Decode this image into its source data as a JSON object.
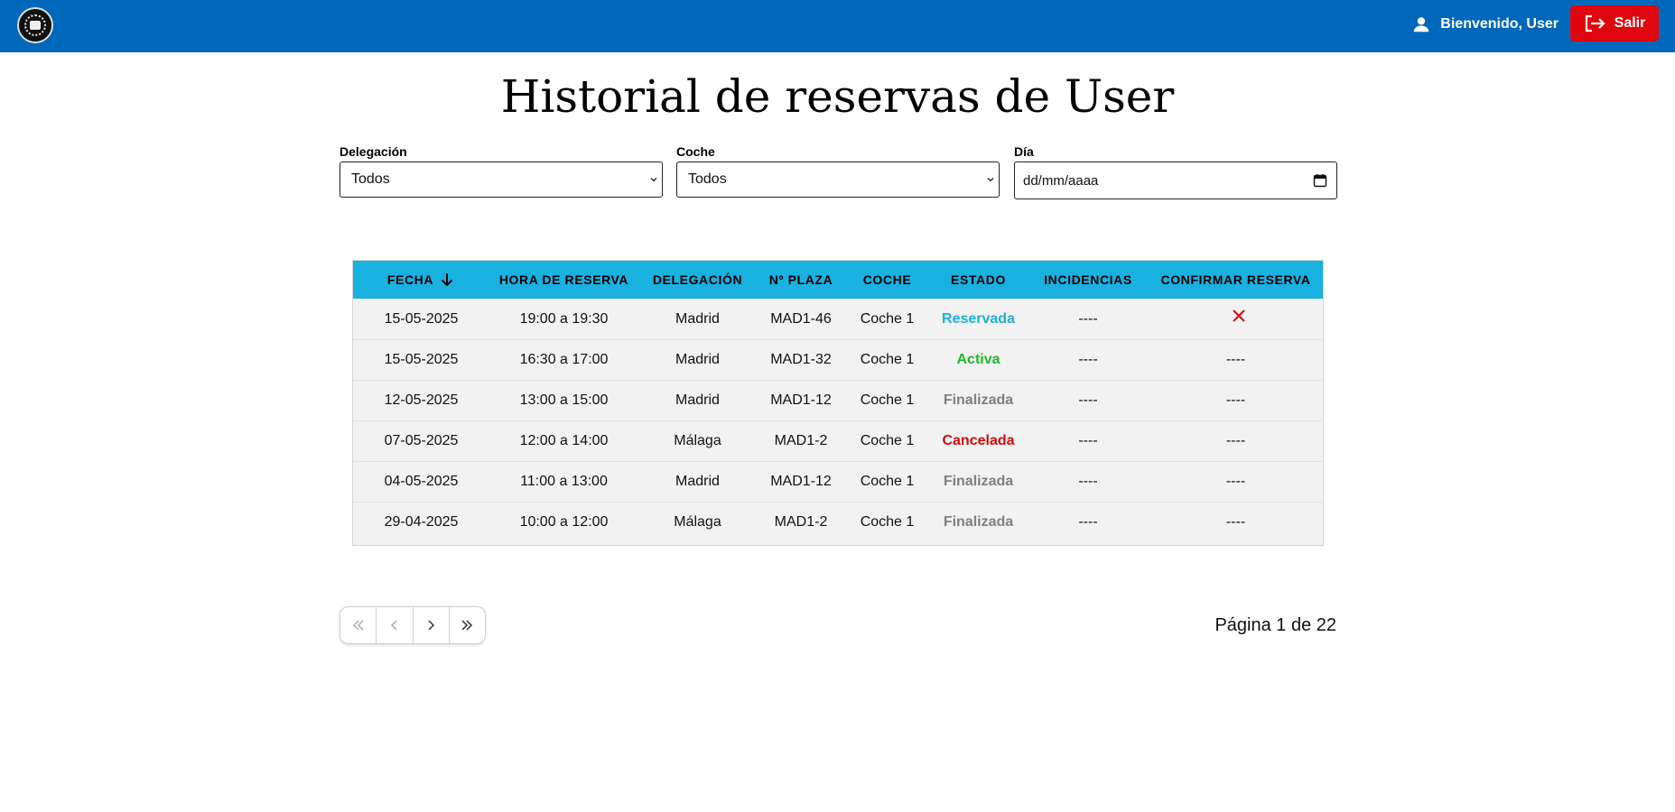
{
  "header": {
    "logo_icon": "emblem-logo",
    "welcome_text": "Bienvenido, User",
    "logout_label": "Salir",
    "colors": {
      "bar": "#0068bb",
      "logout": "#e0060e"
    }
  },
  "page_title": "Historial de reservas de User",
  "filters": {
    "delegacion": {
      "label": "Delegación",
      "value": "Todos"
    },
    "coche": {
      "label": "Coche",
      "value": "Todos"
    },
    "dia": {
      "label": "Día",
      "placeholder": "dd/mm/aaaa"
    }
  },
  "table": {
    "header_color": "#19b1e0",
    "columns": [
      "FECHA",
      "HORA DE RESERVA",
      "DELEGACIÓN",
      "Nº PLAZA",
      "COCHE",
      "ESTADO",
      "INCIDENCIAS",
      "CONFIRMAR RESERVA"
    ],
    "sort": {
      "column": "FECHA",
      "direction": "desc",
      "icon": "arrow-down-icon"
    },
    "rows": [
      {
        "fecha": "15-05-2025",
        "hora": "19:00 a 19:30",
        "delegacion": "Madrid",
        "plaza": "MAD1-46",
        "coche": "Coche 1",
        "estado": "Reservada",
        "incidencias": "----",
        "confirmar": "x-icon"
      },
      {
        "fecha": "15-05-2025",
        "hora": "16:30 a 17:00",
        "delegacion": "Madrid",
        "plaza": "MAD1-32",
        "coche": "Coche 1",
        "estado": "Activa",
        "incidencias": "----",
        "confirmar": "----"
      },
      {
        "fecha": "12-05-2025",
        "hora": "13:00 a 15:00",
        "delegacion": "Madrid",
        "plaza": "MAD1-12",
        "coche": "Coche 1",
        "estado": "Finalizada",
        "incidencias": "----",
        "confirmar": "----"
      },
      {
        "fecha": "07-05-2025",
        "hora": "12:00 a 14:00",
        "delegacion": "Málaga",
        "plaza": "MAD1-2",
        "coche": "Coche 1",
        "estado": "Cancelada",
        "incidencias": "----",
        "confirmar": "----"
      },
      {
        "fecha": "04-05-2025",
        "hora": "11:00 a 13:00",
        "delegacion": "Madrid",
        "plaza": "MAD1-12",
        "coche": "Coche 1",
        "estado": "Finalizada",
        "incidencias": "----",
        "confirmar": "----"
      },
      {
        "fecha": "29-04-2025",
        "hora": "10:00 a 12:00",
        "delegacion": "Málaga",
        "plaza": "MAD1-2",
        "coche": "Coche 1",
        "estado": "Finalizada",
        "incidencias": "----",
        "confirmar": "----"
      }
    ],
    "status_colors": {
      "Reservada": "#1aaed8",
      "Activa": "#1bb82e",
      "Finalizada": "#808080",
      "Cancelada": "#d20b0b"
    }
  },
  "pagination": {
    "buttons": [
      "first-page-icon",
      "previous-page-icon",
      "next-page-icon",
      "last-page-icon"
    ],
    "page_info": "Página 1 de 22"
  }
}
